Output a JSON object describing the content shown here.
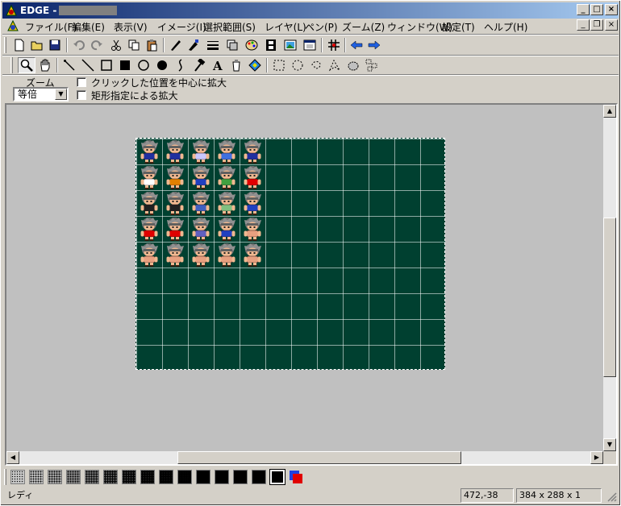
{
  "window": {
    "title": "EDGE - [",
    "minimize": "_",
    "maximize": "□",
    "close": "×"
  },
  "menu": {
    "items": [
      "ファイル(F)",
      "編集(E)",
      "表示(V)",
      "イメージ(I)",
      "選択範囲(S)",
      "レイヤ(L)",
      "ペン(P)",
      "ズーム(Z)",
      "ウィンドウ(W)",
      "設定(T)",
      "ヘルプ(H)"
    ],
    "mdi_min": "_",
    "mdi_restore": "❐",
    "mdi_close": "×"
  },
  "toolbar_main": [
    "new-file-icon",
    "open-folder-icon",
    "save-icon",
    "undo-icon",
    "redo-icon",
    "cut-icon",
    "copy-icon",
    "paste-icon",
    "pen-tool-icon",
    "brush-icon",
    "line-width-icon",
    "layer-icon",
    "palette-icon",
    "film-icon",
    "image-icon",
    "window-icon",
    "grid-icon",
    "arrow-left-icon",
    "arrow-right-icon"
  ],
  "toolbar_tools": [
    "zoom-tool-icon",
    "hand-tool-icon",
    "pencil-tool-icon",
    "line-tool-icon",
    "rectangle-tool-icon",
    "filled-rectangle-tool-icon",
    "ellipse-tool-icon",
    "filled-ellipse-tool-icon",
    "curve-tool-icon",
    "hammer-tool-icon",
    "text-tool-icon",
    "bucket-tool-icon",
    "fill-tool-icon",
    "rect-select-icon",
    "ellipse-select-icon",
    "lasso-select-icon",
    "polygon-select-icon",
    "magic-select-icon",
    "pattern-select-icon"
  ],
  "zoom_options": {
    "label": "ズーム",
    "selected": "等倍",
    "center_zoom_label": "クリックした位置を中心に拡大",
    "rect_zoom_label": "矩形指定による拡大",
    "center_zoom_checked": false,
    "rect_zoom_checked": false
  },
  "canvas": {
    "sprite_rows": 5,
    "sprite_cols": 5,
    "colors": {
      "background": "#004030",
      "grid": "#ffffff"
    }
  },
  "patterns": {
    "count": 16,
    "active_color_fg": "#000000",
    "active_color_bg": "#ffffff"
  },
  "status": {
    "text": "レディ",
    "coords": "472,-38",
    "size": "384 x 288 x 1"
  }
}
